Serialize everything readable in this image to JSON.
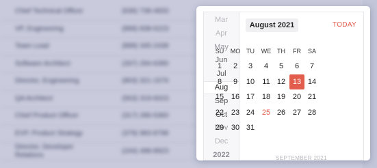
{
  "background_table": {
    "rows": [
      {
        "title": "Chief Technical Officer",
        "phone": "(636) 738-4833"
      },
      {
        "title": "VP, Engineering",
        "phone": "(899) 838-6223"
      },
      {
        "title": "Team Lead",
        "phone": "(899) 345-2438"
      },
      {
        "title": "Software Architect",
        "phone": "(337) 294-6390"
      },
      {
        "title": "Director, Engineering",
        "phone": "(803) 321-1576"
      },
      {
        "title": "QA Architect",
        "phone": "(563) 319-6023"
      },
      {
        "title": "Chief Product Officer",
        "phone": "(317) 286-5360"
      },
      {
        "title": "EVP, Product Strategy",
        "phone": "(379) 983-8798"
      },
      {
        "title": "Director, Developer Relations",
        "phone": "(244) 498-8923"
      }
    ]
  },
  "calendar": {
    "months": [
      "Mar",
      "Apr",
      "May",
      "Jun",
      "Jul",
      "Aug",
      "Sep",
      "Oct",
      "Nov",
      "Dec"
    ],
    "year_label": "2022",
    "selected_month": "Aug",
    "header_title": "August 2021",
    "today_label": "TODAY",
    "weekdays": [
      "SU",
      "MO",
      "TU",
      "WE",
      "TH",
      "FR",
      "SA"
    ],
    "weeks": [
      [
        "1",
        "2",
        "3",
        "4",
        "5",
        "6",
        "7"
      ],
      [
        "8",
        "9",
        "10",
        "11",
        "12",
        "13",
        "14"
      ],
      [
        "15",
        "16",
        "17",
        "18",
        "19",
        "20",
        "21"
      ],
      [
        "22",
        "23",
        "24",
        "25",
        "26",
        "27",
        "28"
      ],
      [
        "29",
        "30",
        "31",
        "",
        "",
        "",
        ""
      ]
    ],
    "selected_day": "13",
    "highlighted_day": "25",
    "next_month_label": "SEPTEMBER 2021",
    "accent_color": "#e35d4c"
  }
}
